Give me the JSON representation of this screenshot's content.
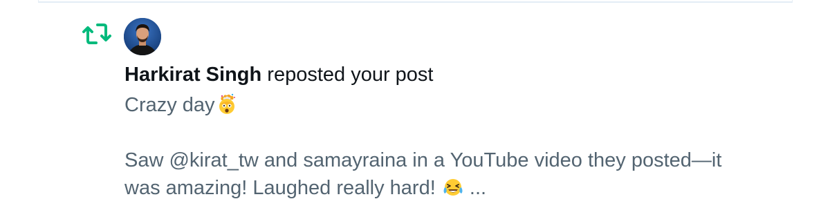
{
  "notification": {
    "type_icon": "repost-icon",
    "author_name": "Harkirat Singh",
    "action_text": "reposted your post",
    "post": {
      "line1_text": "Crazy day",
      "line1_emoji": "exploding-head-emoji",
      "body_line1": "Saw @kirat_tw and samayraina in a YouTube video they posted—it",
      "body_line2_text": "was amazing! Laughed really hard!",
      "body_line2_emoji": "tears-of-joy-emoji",
      "ellipsis": "..."
    }
  },
  "colors": {
    "repost_green": "#00ba7c",
    "name_text": "#0f1419",
    "body_text": "#536471",
    "divider": "#e3edf5"
  }
}
